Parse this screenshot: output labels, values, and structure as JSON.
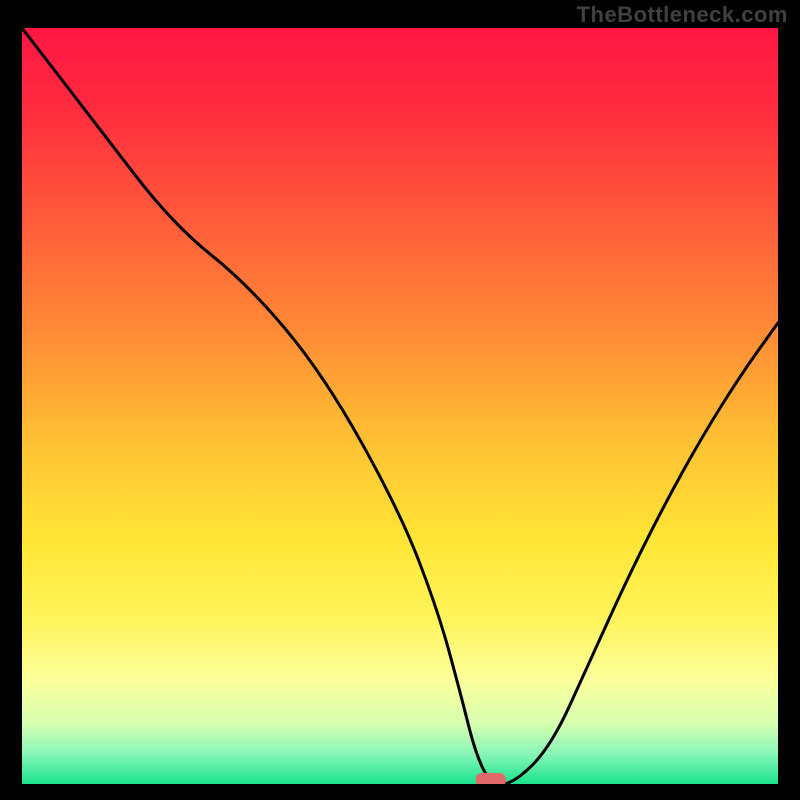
{
  "watermark": "TheBottleneck.com",
  "chart_data": {
    "type": "line",
    "title": "",
    "xlabel": "",
    "ylabel": "",
    "xlim": [
      0,
      100
    ],
    "ylim": [
      0,
      100
    ],
    "grid": false,
    "legend": false,
    "annotations": [],
    "series": [
      {
        "name": "curve",
        "x": [
          0,
          10,
          20,
          30,
          40,
          50,
          55,
          58,
          60,
          62,
          65,
          70,
          75,
          80,
          85,
          90,
          95,
          100
        ],
        "values": [
          100,
          87,
          74,
          66,
          54,
          36,
          23,
          12,
          4,
          0,
          0,
          5,
          16,
          27,
          37,
          46,
          54,
          61
        ]
      }
    ],
    "gradient_bands": {
      "description": "vertical gradient background from top to bottom",
      "stops": [
        {
          "pos": 0.0,
          "color": "#ff1744"
        },
        {
          "pos": 0.1,
          "color": "#ff2a3f"
        },
        {
          "pos": 0.25,
          "color": "#ff5a3a"
        },
        {
          "pos": 0.4,
          "color": "#ff8a36"
        },
        {
          "pos": 0.55,
          "color": "#ffc233"
        },
        {
          "pos": 0.68,
          "color": "#ffe636"
        },
        {
          "pos": 0.78,
          "color": "#fff45a"
        },
        {
          "pos": 0.86,
          "color": "#fdff9a"
        },
        {
          "pos": 0.92,
          "color": "#d7ffb0"
        },
        {
          "pos": 0.96,
          "color": "#88f6b8"
        },
        {
          "pos": 1.0,
          "color": "#19e38d"
        }
      ]
    },
    "marker": {
      "x": 62,
      "y": 0,
      "color": "#e06a6a",
      "shape": "rounded-rect"
    }
  }
}
